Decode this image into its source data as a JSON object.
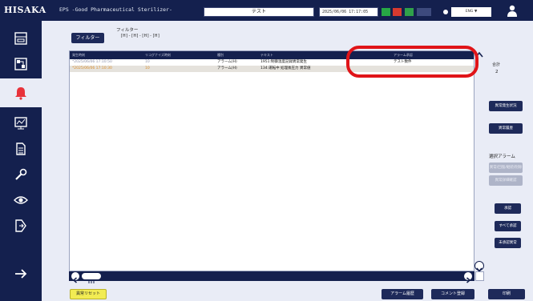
{
  "header": {
    "logo": "HISAKA",
    "app_title": "EPS -Good Pharmaceutical Sterilizer-",
    "user": "テスト",
    "datetime": "2025/06/06 17:17:05",
    "indicators": [
      "GREEN",
      "RED",
      "LIGHT"
    ],
    "language": "ENG  ▼",
    "icons": [
      "settings-dot-icon",
      "person-icon"
    ]
  },
  "nav": {
    "items": [
      "layout-icon",
      "process-icon",
      "alarm-icon",
      "trend-icon",
      "document-icon",
      "maintenance-icon",
      "view-icon",
      "export-icon",
      "next-icon"
    ]
  },
  "filter": {
    "button": "フィルター",
    "title": "フィルター",
    "dates": "[H]-[H]-[H]-[H]"
  },
  "table": {
    "headers": [
      "発生時刻",
      "リコグナイズ時刻",
      "種別",
      "テキスト",
      "アラーム承認"
    ],
    "rows": [
      {
        "time": "*2025/06/06 17:10:50",
        "recognized": "10",
        "type": "アラーム(H)",
        "text": "1951:制御温度記録異常発生",
        "ack": "テスト数件"
      },
      {
        "time": "*2025/06/06 17:10:30",
        "recognized": "10",
        "type": "アラーム(H)",
        "text": "134:運転中 処理後圧力 異常値",
        "ack": ""
      }
    ]
  },
  "right_panel": {
    "count_label": "合計",
    "count_value": "2",
    "history_button": "異常発生状況",
    "history2_button": "異常履歴",
    "selected_label": "選択アラーム",
    "disabled_button1": "異常/回復/継続/削除",
    "disabled_button2": "異常詳細確認",
    "confirm_button": "承認",
    "confirm_all_button": "すべて承認",
    "unconfirmed_button": "未承認異常"
  },
  "bottom": {
    "reset_button": "異常リセット",
    "alarm_history_button": "アラーム履歴",
    "comment_button": "コメント登録",
    "print_button": "印刷"
  },
  "colors": {
    "nav_bg": "#14204e",
    "highlight": "#e01418",
    "reset_yellow": "#f2ec53"
  }
}
